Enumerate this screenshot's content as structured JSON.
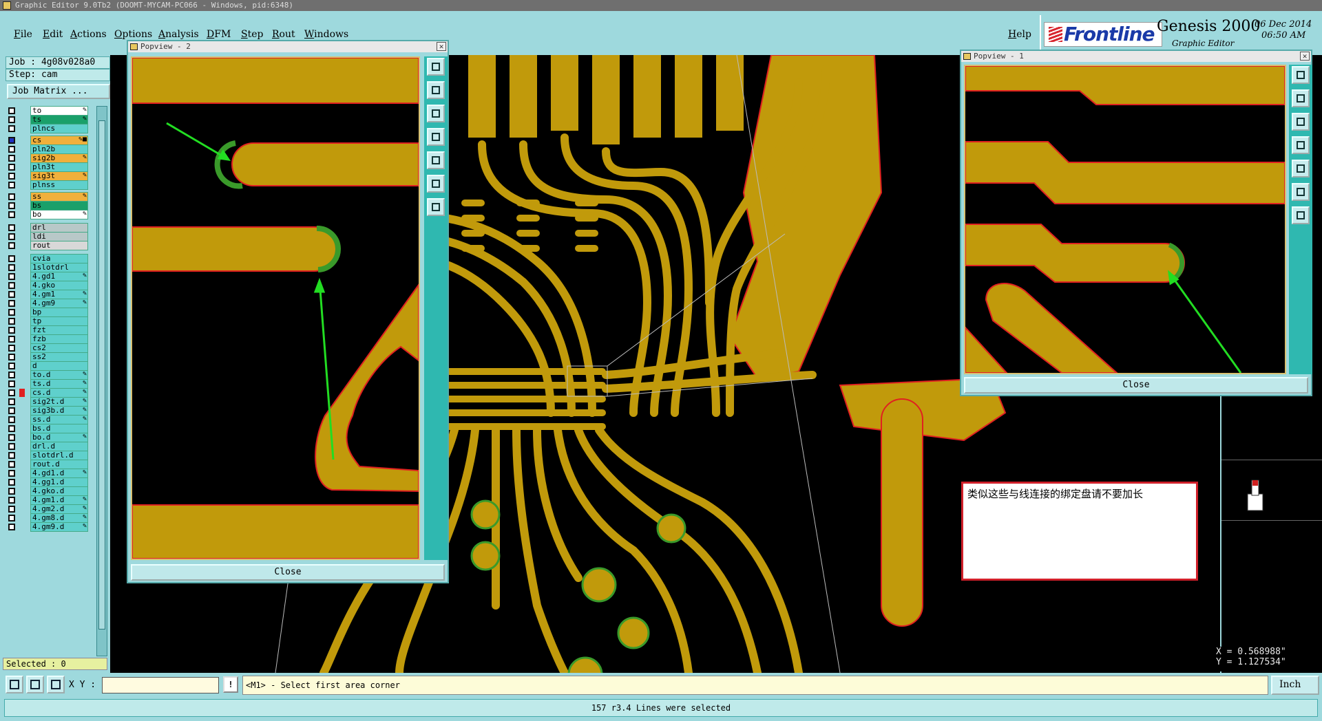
{
  "window": {
    "title": "Graphic Editor 9.0Tb2 (DOOMT-MYCAM-PC066 - Windows, pid:6348)"
  },
  "menu": {
    "items": [
      "File",
      "Edit",
      "Actions",
      "Options",
      "Analysis",
      "DFM",
      "Step",
      "Rout",
      "Windows"
    ],
    "help": "Help"
  },
  "brand": {
    "logo": "Frontline",
    "product": "Genesis 2000",
    "subtitle": "Graphic Editor",
    "date": "06 Dec 2014",
    "time": "06:50 AM"
  },
  "job": {
    "job_line": "Job : 4g08v028a0",
    "step_line": "Step: cam",
    "matrix_button": "Job Matrix ..."
  },
  "layers": [
    {
      "name": "to",
      "color": "#ffffff",
      "flag": "✎"
    },
    {
      "name": "ts",
      "color": "#1aa06a",
      "flag": "✎"
    },
    {
      "name": "plncs",
      "color": "#5fd0cc",
      "flag": ""
    },
    {
      "name": "cs",
      "color": "#f0b03c",
      "flag": "✎■",
      "active": true
    },
    {
      "name": "pln2b",
      "color": "#5fd0cc",
      "flag": ""
    },
    {
      "name": "sig2b",
      "color": "#f0b03c",
      "flag": "✎"
    },
    {
      "name": "pln3t",
      "color": "#5fd0cc",
      "flag": ""
    },
    {
      "name": "sig3t",
      "color": "#f0b03c",
      "flag": "✎"
    },
    {
      "name": "plnss",
      "color": "#5fd0cc",
      "flag": ""
    },
    {
      "name": "ss",
      "color": "#f0b03c",
      "flag": "✎"
    },
    {
      "name": "bs",
      "color": "#1aa06a",
      "flag": ""
    },
    {
      "name": "bo",
      "color": "#ffffff",
      "flag": "✎"
    },
    {
      "name": "drl",
      "color": "#b8c8c8",
      "flag": ""
    },
    {
      "name": "ldi",
      "color": "#b8c8c8",
      "flag": ""
    },
    {
      "name": "rout",
      "color": "#d8d8d8",
      "flag": ""
    },
    {
      "name": "cvia",
      "color": "#5fd0cc",
      "flag": ""
    },
    {
      "name": "1slotdrl",
      "color": "#5fd0cc",
      "flag": ""
    },
    {
      "name": "4.gd1",
      "color": "#5fd0cc",
      "flag": "✎"
    },
    {
      "name": "4.gko",
      "color": "#5fd0cc",
      "flag": ""
    },
    {
      "name": "4.gm1",
      "color": "#5fd0cc",
      "flag": "✎"
    },
    {
      "name": "4.gm9",
      "color": "#5fd0cc",
      "flag": "✎"
    },
    {
      "name": "bp",
      "color": "#5fd0cc",
      "flag": ""
    },
    {
      "name": "tp",
      "color": "#5fd0cc",
      "flag": ""
    },
    {
      "name": "fzt",
      "color": "#5fd0cc",
      "flag": ""
    },
    {
      "name": "fzb",
      "color": "#5fd0cc",
      "flag": ""
    },
    {
      "name": "cs2",
      "color": "#5fd0cc",
      "flag": ""
    },
    {
      "name": "ss2",
      "color": "#5fd0cc",
      "flag": ""
    },
    {
      "name": "d",
      "color": "#5fd0cc",
      "flag": ""
    },
    {
      "name": "to.d",
      "color": "#5fd0cc",
      "flag": "✎"
    },
    {
      "name": "ts.d",
      "color": "#5fd0cc",
      "flag": "✎"
    },
    {
      "name": "cs.d",
      "color": "#5fd0cc",
      "flag": "✎",
      "red": true
    },
    {
      "name": "sig2t.d",
      "color": "#5fd0cc",
      "flag": "✎"
    },
    {
      "name": "sig3b.d",
      "color": "#5fd0cc",
      "flag": "✎"
    },
    {
      "name": "ss.d",
      "color": "#5fd0cc",
      "flag": "✎"
    },
    {
      "name": "bs.d",
      "color": "#5fd0cc",
      "flag": ""
    },
    {
      "name": "bo.d",
      "color": "#5fd0cc",
      "flag": "✎"
    },
    {
      "name": "drl.d",
      "color": "#5fd0cc",
      "flag": ""
    },
    {
      "name": "slotdrl.d",
      "color": "#5fd0cc",
      "flag": ""
    },
    {
      "name": "rout.d",
      "color": "#5fd0cc",
      "flag": ""
    },
    {
      "name": "4.gd1.d",
      "color": "#5fd0cc",
      "flag": "✎"
    },
    {
      "name": "4.gg1.d",
      "color": "#5fd0cc",
      "flag": ""
    },
    {
      "name": "4.gko.d",
      "color": "#5fd0cc",
      "flag": ""
    },
    {
      "name": "4.gm1.d",
      "color": "#5fd0cc",
      "flag": "✎"
    },
    {
      "name": "4.gm2.d",
      "color": "#5fd0cc",
      "flag": "✎"
    },
    {
      "name": "4.gm8.d",
      "color": "#5fd0cc",
      "flag": "✎"
    },
    {
      "name": "4.gm9.d",
      "color": "#5fd0cc",
      "flag": "✎"
    }
  ],
  "selected": "Selected : 0",
  "popview2": {
    "title": "Popview - 2",
    "close": "Close"
  },
  "popview1": {
    "title": "Popview - 1",
    "close": "Close"
  },
  "note": "类似这些与线连接的绑定盘请不要加长",
  "coords": {
    "x": "X = 0.568988\"",
    "y": "Y = 1.127534\""
  },
  "bottom": {
    "xy_label": "X Y :",
    "xy_value": "",
    "warn": "!",
    "prompt": "<M1> - Select first area corner",
    "units": "Inch",
    "status": "157 r3.4 Lines were selected"
  },
  "colors": {
    "copper": "#c19a0b",
    "mask": "#3a9a2a",
    "edge": "#e02020",
    "arrow": "#22dd22"
  }
}
